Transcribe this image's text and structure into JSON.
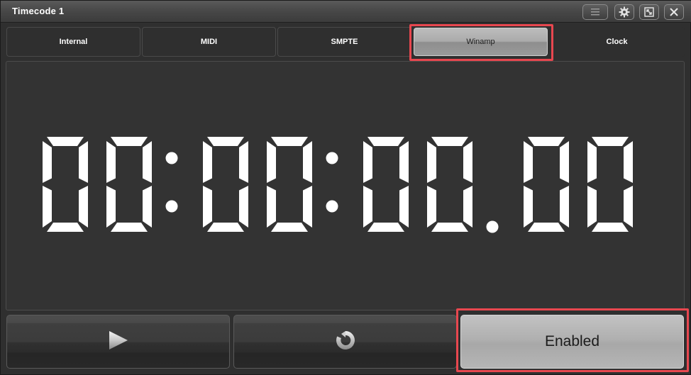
{
  "window": {
    "title": "Timecode 1",
    "controls": [
      "menu-icon",
      "gear-icon",
      "resize-icon",
      "close-icon"
    ]
  },
  "tabs": [
    {
      "label": "Internal",
      "active": false
    },
    {
      "label": "MIDI",
      "active": false
    },
    {
      "label": "SMPTE",
      "active": false
    },
    {
      "label": "Winamp",
      "active": true
    },
    {
      "label": "Clock",
      "active": false
    }
  ],
  "display": {
    "timecode": "00:00:00.00"
  },
  "controls": {
    "play_icon": "play-icon",
    "reset_icon": "reset-icon",
    "enabled_label": "Enabled"
  },
  "colors": {
    "background": "#2f2f2f",
    "segment": "#ffffff",
    "active_tab": "#aaaaaa",
    "highlight": "#e8474f"
  }
}
